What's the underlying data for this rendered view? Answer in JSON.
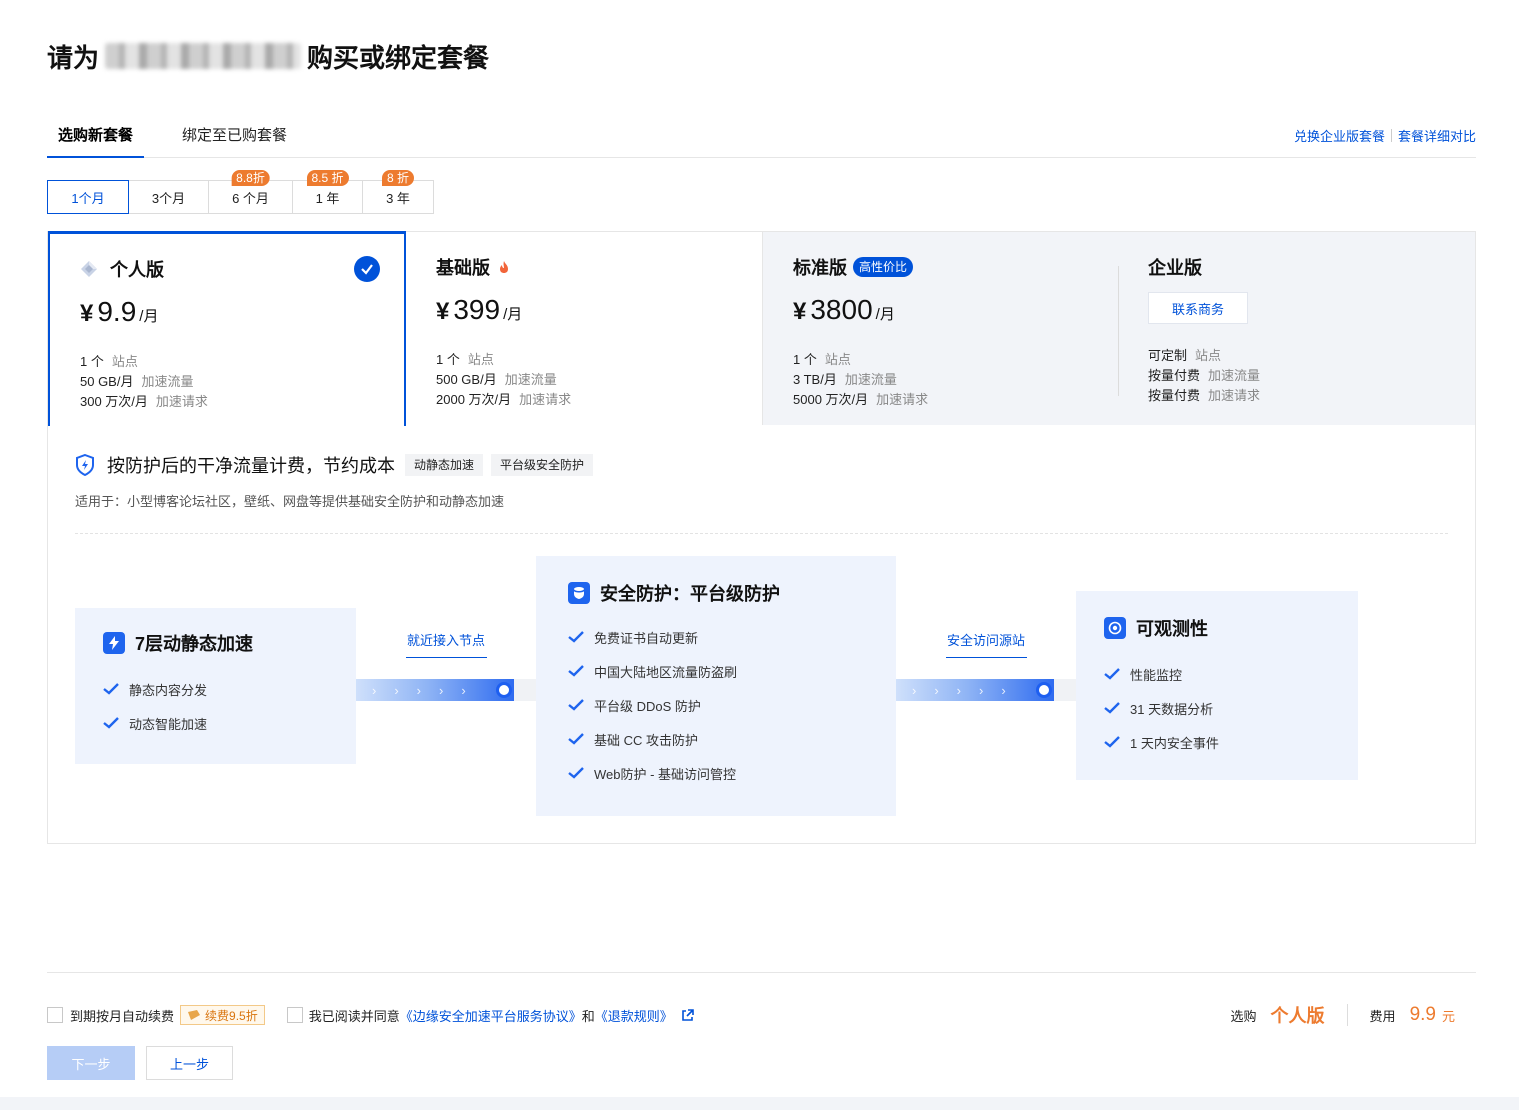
{
  "page": {
    "title_prefix": "请为",
    "title_suffix": "购买或绑定套餐"
  },
  "tabs": [
    {
      "label": "选购新套餐",
      "active": true
    },
    {
      "label": "绑定至已购套餐",
      "active": false
    }
  ],
  "top_links": {
    "exchange": "兑换企业版套餐",
    "compare": "套餐详细对比"
  },
  "durations": [
    {
      "label": "1个月",
      "badge": "",
      "active": true
    },
    {
      "label": "3个月",
      "badge": ""
    },
    {
      "label": "6 个月",
      "badge": "8.8折"
    },
    {
      "label": "1 年",
      "badge": "8.5 折"
    },
    {
      "label": "3 年",
      "badge": "8 折"
    }
  ],
  "plans": {
    "personal": {
      "name": "个人版",
      "currency": "¥",
      "price": "9.9",
      "unit": "/月",
      "specs": [
        {
          "v": "1 个",
          "k": "站点"
        },
        {
          "v": "50 GB/月",
          "k": "加速流量"
        },
        {
          "v": "300 万次/月",
          "k": "加速请求"
        }
      ]
    },
    "basic": {
      "name": "基础版",
      "currency": "¥",
      "price": "399",
      "unit": "/月",
      "specs": [
        {
          "v": "1 个",
          "k": "站点"
        },
        {
          "v": "500 GB/月",
          "k": "加速流量"
        },
        {
          "v": "2000 万次/月",
          "k": "加速请求"
        }
      ]
    },
    "standard": {
      "name": "标准版",
      "tag": "高性价比",
      "currency": "¥",
      "price": "3800",
      "unit": "/月",
      "specs": [
        {
          "v": "1 个",
          "k": "站点"
        },
        {
          "v": "3 TB/月",
          "k": "加速流量"
        },
        {
          "v": "5000 万次/月",
          "k": "加速请求"
        }
      ]
    },
    "enterprise": {
      "name": "企业版",
      "contact": "联系商务",
      "specs": [
        {
          "v": "可定制",
          "k": "站点"
        },
        {
          "v": "按量付费",
          "k": "加速流量"
        },
        {
          "v": "按量付费",
          "k": "加速请求"
        }
      ]
    }
  },
  "feature": {
    "headline": "按防护后的干净流量计费，节约成本",
    "chips": [
      "动静态加速",
      "平台级安全防护"
    ],
    "subtitle": "适用于：小型博客论坛社区，壁纸、网盘等提供基础安全防护和动静态加速"
  },
  "flow": {
    "accel": {
      "title": "7层动静态加速",
      "items": [
        "静态内容分发",
        "动态智能加速"
      ]
    },
    "conn1": "就近接入节点",
    "security": {
      "title": "安全防护：平台级防护",
      "items": [
        "免费证书自动更新",
        "中国大陆地区流量防盗刷",
        "平台级 DDoS 防护",
        "基础 CC 攻击防护",
        "Web防护 - 基础访问管控"
      ]
    },
    "conn2": "安全访问源站",
    "observe": {
      "title": "可观测性",
      "items": [
        "性能监控",
        "31 天数据分析",
        "1 天内安全事件"
      ]
    }
  },
  "bottom": {
    "auto_renew": "到期按月自动续费",
    "renew_tag": "续费9.5折",
    "agree_prefix": "我已阅读并同意",
    "agreement": "《边缘安全加速平台服务协议》",
    "and": "和",
    "refund": "《退款规则》",
    "pick_label": "选购",
    "pick_value": "个人版",
    "fee_label": "费用",
    "fee_value": "9.9",
    "fee_unit": "元",
    "next": "下一步",
    "prev": "上一步"
  },
  "colors": {
    "accent": "#0052d9",
    "orange": "#ed7b2f"
  }
}
